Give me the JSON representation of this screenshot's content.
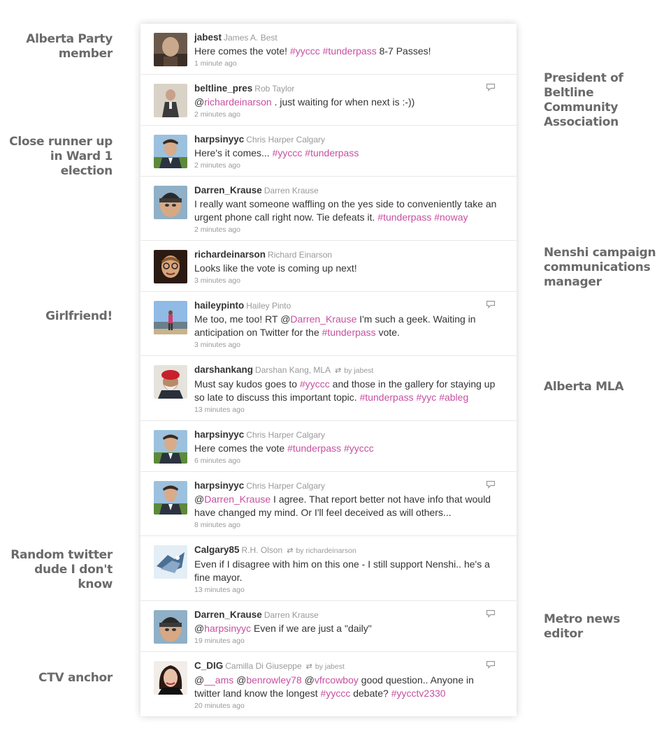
{
  "annotations": [
    {
      "side": "left",
      "text": "Alberta Party\nmember"
    },
    {
      "side": "left",
      "text": "Close runner up\nin Ward 1 election"
    },
    {
      "side": "left",
      "text": "Girlfriend!"
    },
    {
      "side": "left",
      "text": "Random twitter\ndude I don't\nknow"
    },
    {
      "side": "left",
      "text": "CTV anchor"
    },
    {
      "side": "right",
      "text": "President of\nBeltline\nCommunity\nAssociation"
    },
    {
      "side": "right",
      "text": "Nenshi campaign\ncommunications\nmanager"
    },
    {
      "side": "right",
      "text": "Alberta MLA"
    },
    {
      "side": "right",
      "text": "Metro news\neditor"
    }
  ],
  "colors": {
    "link": "#c74f9f",
    "username": "#333333",
    "meta": "#999999",
    "annotation": "#6a6a6a"
  },
  "tweets": [
    {
      "username": "jabest",
      "fullname": "James A. Best",
      "retweeted_by": "",
      "reply_icon": false,
      "avatar": "bald-man-avatar",
      "segments": [
        {
          "t": "Here comes the vote! "
        },
        {
          "t": "#yyccc",
          "link": true
        },
        {
          "t": " "
        },
        {
          "t": "#tunderpass",
          "link": true
        },
        {
          "t": " 8-7 Passes!"
        }
      ],
      "time": "1 minute ago"
    },
    {
      "username": "beltline_pres",
      "fullname": "Rob Taylor",
      "retweeted_by": "",
      "reply_icon": true,
      "avatar": "speaker-avatar",
      "segments": [
        {
          "t": "@"
        },
        {
          "t": "richardeinarson",
          "link": true
        },
        {
          "t": " . just waiting for when next is :-))"
        }
      ],
      "time": "2 minutes ago"
    },
    {
      "username": "harpsinyyc",
      "fullname": "Chris Harper Calgary",
      "retweeted_by": "",
      "reply_icon": false,
      "avatar": "suit-man-avatar",
      "segments": [
        {
          "t": "Here's it comes... "
        },
        {
          "t": "#yyccc",
          "link": true
        },
        {
          "t": " "
        },
        {
          "t": "#tunderpass",
          "link": true
        }
      ],
      "time": "2 minutes ago"
    },
    {
      "username": "Darren_Krause",
      "fullname": "Darren Krause",
      "retweeted_by": "",
      "reply_icon": false,
      "avatar": "toque-man-avatar",
      "segments": [
        {
          "t": "I really want someone waffling on the yes side to conveniently take an urgent phone call right now. Tie defeats it. "
        },
        {
          "t": "#tunderpass",
          "link": true
        },
        {
          "t": " "
        },
        {
          "t": "#noway",
          "link": true
        }
      ],
      "time": "2 minutes ago"
    },
    {
      "username": "richardeinarson",
      "fullname": "Richard Einarson",
      "retweeted_by": "",
      "reply_icon": false,
      "avatar": "glasses-man-avatar",
      "segments": [
        {
          "t": "Looks like the vote is coming up next!"
        }
      ],
      "time": "3 minutes ago"
    },
    {
      "username": "haileypinto",
      "fullname": "Hailey Pinto",
      "retweeted_by": "",
      "reply_icon": true,
      "avatar": "outdoor-woman-avatar",
      "segments": [
        {
          "t": "Me too, me too! RT @"
        },
        {
          "t": "Darren_Krause",
          "link": true
        },
        {
          "t": " I'm such a geek. Waiting in anticipation on Twitter for the "
        },
        {
          "t": "#tunderpass",
          "link": true
        },
        {
          "t": " vote."
        }
      ],
      "time": "3 minutes ago"
    },
    {
      "username": "darshankang",
      "fullname": "Darshan Kang, MLA",
      "retweeted_by": "by jabest",
      "reply_icon": false,
      "avatar": "turban-man-avatar",
      "segments": [
        {
          "t": "Must say kudos goes to "
        },
        {
          "t": "#yyccc",
          "link": true
        },
        {
          "t": " and those in the gallery for staying up so late to discuss this important topic. "
        },
        {
          "t": "#tunderpass",
          "link": true
        },
        {
          "t": " "
        },
        {
          "t": "#yyc",
          "link": true
        },
        {
          "t": " "
        },
        {
          "t": "#ableg",
          "link": true
        }
      ],
      "time": "13 minutes ago"
    },
    {
      "username": "harpsinyyc",
      "fullname": "Chris Harper Calgary",
      "retweeted_by": "",
      "reply_icon": false,
      "avatar": "suit-man-avatar",
      "segments": [
        {
          "t": "Here comes the vote "
        },
        {
          "t": "#tunderpass",
          "link": true
        },
        {
          "t": " "
        },
        {
          "t": "#yyccc",
          "link": true
        }
      ],
      "time": "6 minutes ago"
    },
    {
      "username": "harpsinyyc",
      "fullname": "Chris Harper Calgary",
      "retweeted_by": "",
      "reply_icon": true,
      "avatar": "suit-man-avatar",
      "segments": [
        {
          "t": "@"
        },
        {
          "t": "Darren_Krause",
          "link": true
        },
        {
          "t": " I agree. That report better not have info that would have changed my mind. Or I'll feel deceived as will others..."
        }
      ],
      "time": "8 minutes ago"
    },
    {
      "username": "Calgary85",
      "fullname": "R.H. Olson",
      "retweeted_by": "by richardeinarson",
      "reply_icon": false,
      "avatar": "abstract-avatar",
      "segments": [
        {
          "t": "Even if I disagree with him on this one - I still support Nenshi.. he's a fine mayor."
        }
      ],
      "time": "13 minutes ago"
    },
    {
      "username": "Darren_Krause",
      "fullname": "Darren Krause",
      "retweeted_by": "",
      "reply_icon": true,
      "avatar": "toque-man-avatar",
      "segments": [
        {
          "t": "@"
        },
        {
          "t": "harpsinyyc",
          "link": true
        },
        {
          "t": " Even if we are just a \"daily\""
        }
      ],
      "time": "19 minutes ago"
    },
    {
      "username": "C_DIG",
      "fullname": "Camilla Di Giuseppe",
      "retweeted_by": "by jabest",
      "reply_icon": true,
      "avatar": "woman-anchor-avatar",
      "segments": [
        {
          "t": "@"
        },
        {
          "t": "__ams",
          "link": true
        },
        {
          "t": " @"
        },
        {
          "t": "benrowley78",
          "link": true
        },
        {
          "t": " @"
        },
        {
          "t": "vfrcowboy",
          "link": true
        },
        {
          "t": " good question.. Anyone in twitter land know the longest "
        },
        {
          "t": "#yyccc",
          "link": true
        },
        {
          "t": " debate? "
        },
        {
          "t": "#yycctv2330",
          "link": true
        }
      ],
      "time": "20 minutes ago"
    }
  ]
}
